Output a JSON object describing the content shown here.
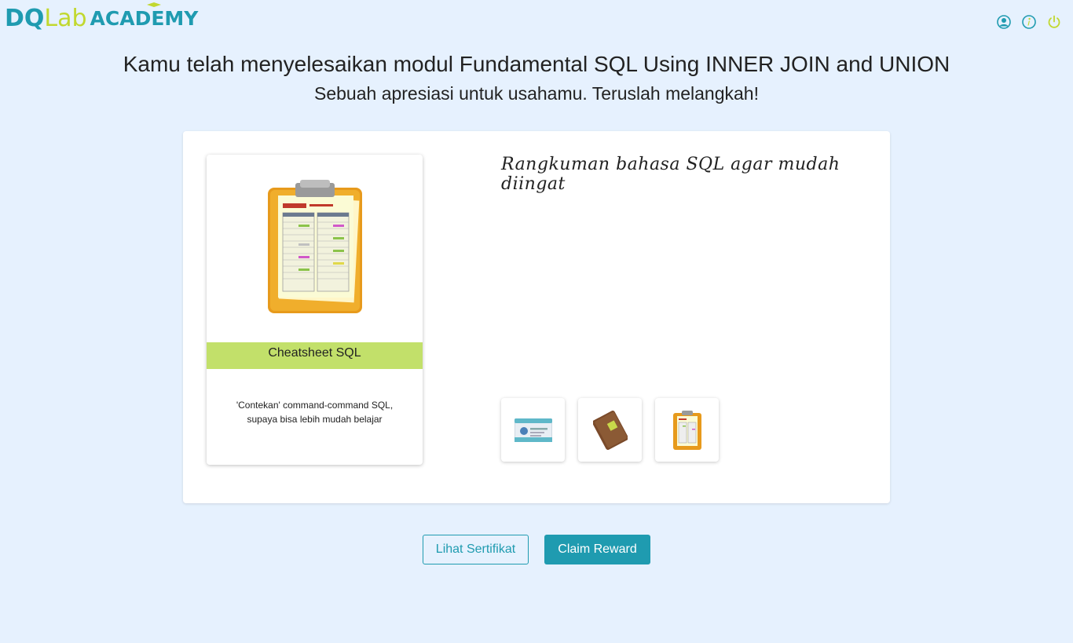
{
  "header": {
    "logo": {
      "part1": "DQ",
      "part2": "Lab",
      "part3": "ACADEMY"
    },
    "icons": [
      "profile-icon",
      "info-icon",
      "power-icon"
    ],
    "colors": {
      "brand_teal": "#1f9bb0",
      "brand_lime": "#c1d82f"
    }
  },
  "main": {
    "title": "Kamu telah menyelesaikan modul Fundamental SQL Using INNER JOIN and UNION",
    "subtitle": "Sebuah apresiasi untuk usahamu. Teruslah melangkah!"
  },
  "reward_panel": {
    "card": {
      "image_icon": "clipboard-icon",
      "label": "Cheatsheet SQL",
      "description_line1": "'Contekan' command-command SQL,",
      "description_line2": "supaya bisa lebih mudah belajar"
    },
    "headline": "Rangkuman bahasa SQL agar mudah diingat",
    "thumbnails": [
      {
        "icon": "id-card-icon"
      },
      {
        "icon": "notebook-icon"
      },
      {
        "icon": "clipboard-icon"
      }
    ]
  },
  "actions": {
    "view_certificate": "Lihat Sertifikat",
    "claim_reward": "Claim Reward"
  }
}
